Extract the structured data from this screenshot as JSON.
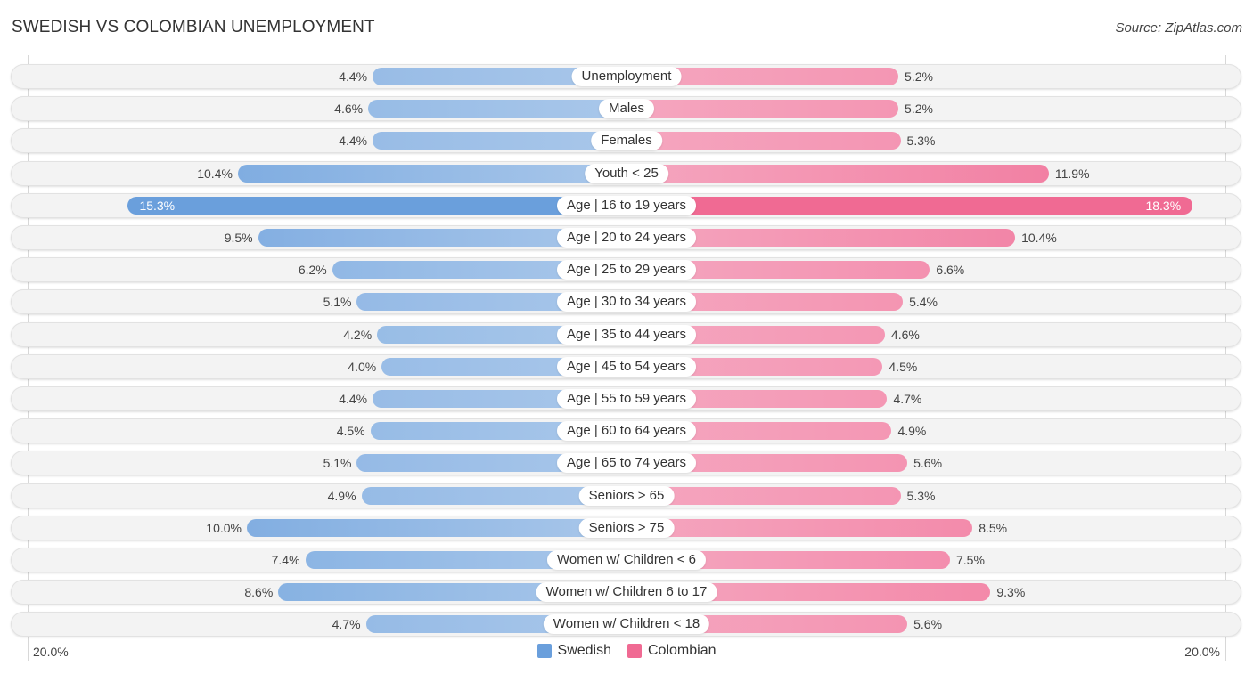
{
  "header": {
    "title": "SWEDISH VS COLOMBIAN UNEMPLOYMENT",
    "source": "Source: ZipAtlas.com"
  },
  "colors": {
    "swedish": "#6a9fdc",
    "swedish_light": "#a9c7ea",
    "colombian": "#f06a93",
    "colombian_light": "#f5a6bf"
  },
  "chart_data": {
    "type": "bar",
    "orientation": "horizontal-diverging",
    "title": "SWEDISH VS COLOMBIAN UNEMPLOYMENT",
    "xlabel": "",
    "ylabel": "",
    "xlim": [
      0,
      20.0
    ],
    "axis_labels": {
      "left": "20.0%",
      "right": "20.0%"
    },
    "legend_position": "bottom-center",
    "categories": [
      "Unemployment",
      "Males",
      "Females",
      "Youth < 25",
      "Age | 16 to 19 years",
      "Age | 20 to 24 years",
      "Age | 25 to 29 years",
      "Age | 30 to 34 years",
      "Age | 35 to 44 years",
      "Age | 45 to 54 years",
      "Age | 55 to 59 years",
      "Age | 60 to 64 years",
      "Age | 65 to 74 years",
      "Seniors > 65",
      "Seniors > 75",
      "Women w/ Children < 6",
      "Women w/ Children 6 to 17",
      "Women w/ Children < 18"
    ],
    "series": [
      {
        "name": "Swedish",
        "values": [
          4.4,
          4.6,
          4.4,
          10.4,
          15.3,
          9.5,
          6.2,
          5.1,
          4.2,
          4.0,
          4.4,
          4.5,
          5.1,
          4.9,
          10.0,
          7.4,
          8.6,
          4.7
        ],
        "labels": [
          "4.4%",
          "4.6%",
          "4.4%",
          "10.4%",
          "15.3%",
          "9.5%",
          "6.2%",
          "5.1%",
          "4.2%",
          "4.0%",
          "4.4%",
          "4.5%",
          "5.1%",
          "4.9%",
          "10.0%",
          "7.4%",
          "8.6%",
          "4.7%"
        ]
      },
      {
        "name": "Colombian",
        "values": [
          5.2,
          5.2,
          5.3,
          11.9,
          18.3,
          10.4,
          6.6,
          5.4,
          4.6,
          4.5,
          4.7,
          4.9,
          5.6,
          5.3,
          8.5,
          7.5,
          9.3,
          5.6
        ],
        "labels": [
          "5.2%",
          "5.2%",
          "5.3%",
          "11.9%",
          "18.3%",
          "10.4%",
          "6.6%",
          "5.4%",
          "4.6%",
          "4.5%",
          "4.7%",
          "4.9%",
          "5.6%",
          "5.3%",
          "8.5%",
          "7.5%",
          "9.3%",
          "5.6%"
        ]
      }
    ]
  },
  "legend": [
    {
      "label": "Swedish"
    },
    {
      "label": "Colombian"
    }
  ]
}
